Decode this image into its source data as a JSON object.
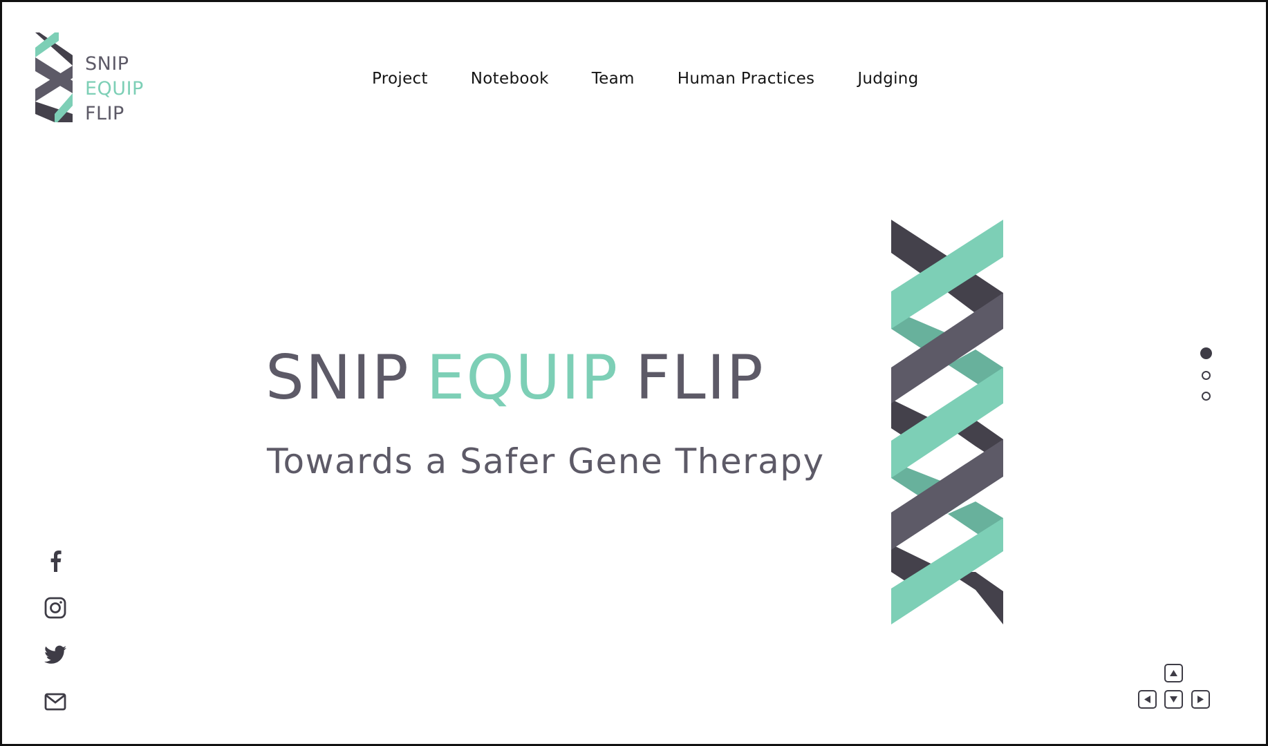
{
  "brand": {
    "logo_line1": "SNIP",
    "logo_line2": "EQUIP",
    "logo_line3": "FLIP"
  },
  "nav": {
    "items": [
      {
        "label": "Project"
      },
      {
        "label": "Notebook"
      },
      {
        "label": "Team"
      },
      {
        "label": "Human Practices"
      },
      {
        "label": "Judging"
      }
    ]
  },
  "hero": {
    "title_word1": "SNIP",
    "title_word2": "EQUIP",
    "title_word3": "FLIP",
    "subtitle": "Towards a Safer Gene Therapy"
  },
  "slider": {
    "slide_count": 3,
    "active_index": 0
  },
  "socials": [
    {
      "icon": "facebook-icon"
    },
    {
      "icon": "instagram-icon"
    },
    {
      "icon": "twitter-icon"
    },
    {
      "icon": "mail-icon"
    }
  ],
  "keyboard_hint": {
    "icons": [
      "arrow-up-key-icon",
      "arrow-left-key-icon",
      "arrow-down-key-icon",
      "arrow-right-key-icon"
    ]
  },
  "colors": {
    "dark": "#5d5a67",
    "darker": "#44414b",
    "accent": "#7dcfb6",
    "accent_shade": "#68b19c",
    "text": "#151515"
  }
}
